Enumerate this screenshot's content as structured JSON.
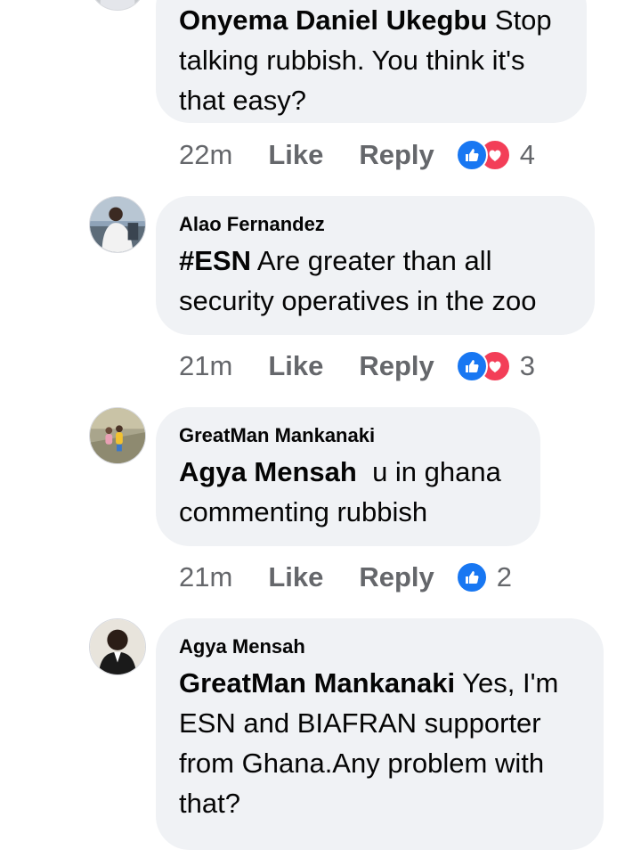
{
  "comments": [
    {
      "author": "",
      "mention": "Onyema Daniel Ukegbu",
      "text": " Stop talking rubbish. You think it's that easy?",
      "time": "22m",
      "like_label": "Like",
      "reply_label": "Reply",
      "reactions": [
        "like-icon",
        "love-icon"
      ],
      "reaction_count": "4"
    },
    {
      "author": "Alao Fernandez",
      "mention": "#ESN",
      "text": " Are greater than all security operatives in the zoo",
      "time": "21m",
      "like_label": "Like",
      "reply_label": "Reply",
      "reactions": [
        "like-icon",
        "love-icon"
      ],
      "reaction_count": "3"
    },
    {
      "author": "GreatMan Mankanaki",
      "mention": "Agya Mensah",
      "text": "  u in ghana commenting rubbish",
      "time": "21m",
      "like_label": "Like",
      "reply_label": "Reply",
      "reactions": [
        "like-icon"
      ],
      "reaction_count": "2"
    },
    {
      "author": "Agya Mensah",
      "mention": "GreatMan Mankanaki",
      "text": " Yes, I'm ESN and BIAFRAN supporter from Ghana.Any problem with that?"
    }
  ],
  "colors": {
    "bubble": "#f0f2f5",
    "meta_text": "#65676b",
    "like_blue": "#1877f2",
    "love_red": "#f33e58"
  }
}
